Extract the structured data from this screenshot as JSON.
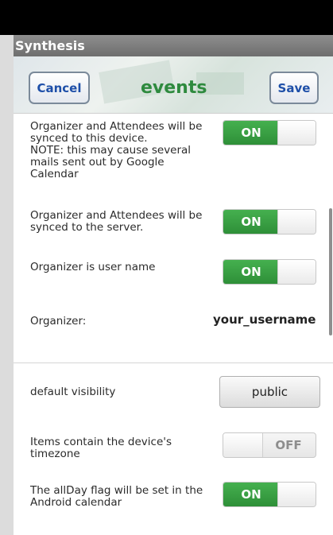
{
  "app": {
    "title": "Synthesis"
  },
  "header": {
    "cancel_label": "Cancel",
    "title": "events",
    "save_label": "Save"
  },
  "settings": [
    {
      "label_lines": [
        "Organizer and Attendees will be",
        "synced to this device.",
        "NOTE: this may cause several",
        "mails sent out by Google",
        "Calendar"
      ],
      "state": "ON"
    },
    {
      "label_lines": [
        "Organizer and Attendees will be",
        "synced to the server."
      ],
      "state": "ON"
    },
    {
      "label_lines": [
        "Organizer is user name"
      ],
      "state": "ON"
    },
    {
      "label_lines": [
        "Organizer:"
      ],
      "value": "your_username"
    },
    {
      "label_lines": [
        "default visibility"
      ],
      "select_value": "public"
    },
    {
      "label_lines": [
        "Items contain the device's",
        "timezone"
      ],
      "state": "OFF"
    },
    {
      "label_lines": [
        "The allDay flag will be set in the",
        "Android calendar"
      ],
      "state": "ON"
    }
  ],
  "colors": {
    "accent_green": "#2e8a3e",
    "toggle_on": "#3aa446",
    "button_text": "#1e4fa8"
  }
}
